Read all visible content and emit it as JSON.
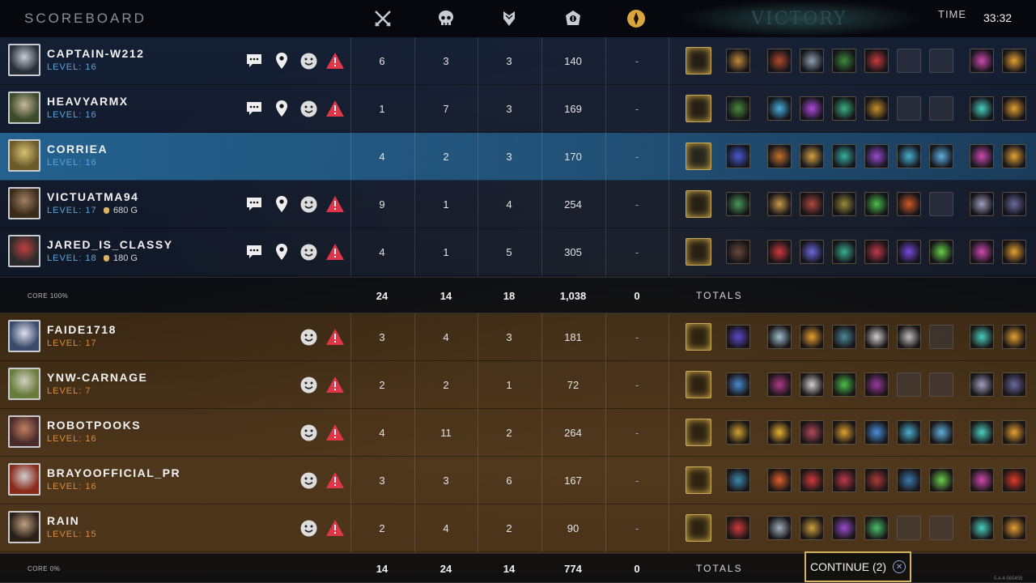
{
  "header": {
    "title": "SCOREBOARD",
    "result": "VICTORY",
    "time_label": "TIME",
    "time_value": "33:32",
    "column_icons": [
      "kills-icon",
      "deaths-icon",
      "assists-icon",
      "minions-icon",
      "objective-icon"
    ]
  },
  "colors": {
    "team_a_level": "#5aa7e0",
    "team_b_level": "#e08b3a",
    "ping_red": "#e0364a",
    "accent_gold": "#d8b25e",
    "selected_row": "#2a6fa0"
  },
  "team_a": {
    "players": [
      {
        "name": "CAPTAIN-W212",
        "level": "LEVEL: 16",
        "gold": "",
        "kills": "6",
        "deaths": "3",
        "assists": "3",
        "cs": "140",
        "obj": "-",
        "actions": true,
        "selected": false,
        "portrait": [
          "#2a2e38",
          "#c9ccd6"
        ],
        "items": [
          "#d9b24a",
          "#c48a3a",
          "#b04a2a",
          "#8da0b0",
          "#3e8a3a",
          "#c83a3a",
          "empty",
          "empty",
          "#d04ab0",
          "#e8a030"
        ]
      },
      {
        "name": "HEAVYARMX",
        "level": "LEVEL: 16",
        "gold": "",
        "kills": "1",
        "deaths": "7",
        "assists": "3",
        "cs": "169",
        "obj": "-",
        "actions": true,
        "selected": false,
        "portrait": [
          "#3a4a2a",
          "#c8b89a"
        ],
        "items": [
          "#d9b24a",
          "#4a8a3a",
          "#4ab0e0",
          "#b04ae0",
          "#3ab080",
          "#c8902a",
          "empty",
          "empty",
          "#4ad0c0",
          "#e8a030"
        ]
      },
      {
        "name": "CORRIEA",
        "level": "LEVEL: 16",
        "gold": "",
        "kills": "4",
        "deaths": "2",
        "assists": "3",
        "cs": "170",
        "obj": "-",
        "actions": false,
        "selected": true,
        "portrait": [
          "#6a5a2a",
          "#d8c070"
        ],
        "items": [
          "#d9b24a",
          "#4a5ad0",
          "#c8702a",
          "#d8a040",
          "#3ab0a0",
          "#9a4ad0",
          "#4ab0d0",
          "#60b0e0",
          "#d04ab0",
          "#e8a030"
        ]
      },
      {
        "name": "VICTUATMA94",
        "level": "LEVEL: 17",
        "gold": "680 G",
        "kills": "9",
        "deaths": "1",
        "assists": "4",
        "cs": "254",
        "obj": "-",
        "actions": true,
        "selected": false,
        "portrait": [
          "#3a2a1a",
          "#a08060"
        ],
        "items": [
          "#d9b24a",
          "#4a9a5a",
          "#c89a4a",
          "#b04a3a",
          "#9a8a3a",
          "#4ac04a",
          "#d05a2a",
          "empty",
          "#a0a0c0",
          "#6a6aa0"
        ]
      },
      {
        "name": "JARED_IS_CLASSY",
        "level": "LEVEL: 18",
        "gold": "180 G",
        "kills": "4",
        "deaths": "1",
        "assists": "5",
        "cs": "305",
        "obj": "-",
        "actions": true,
        "selected": false,
        "portrait": [
          "#2a2a2a",
          "#c04040"
        ],
        "items": [
          "#d9b24a",
          "#6a4a3a",
          "#d03a3a",
          "#6a6ae0",
          "#3ab090",
          "#c03a4a",
          "#7a4ae0",
          "#6ad04a",
          "#d04ab0",
          "#e8a030"
        ]
      }
    ],
    "core": "CORE 100%",
    "totals": {
      "kills": "24",
      "deaths": "14",
      "assists": "18",
      "cs": "1,038",
      "obj": "0",
      "label": "TOTALS"
    }
  },
  "team_b": {
    "players": [
      {
        "name": "FAIDE1718",
        "level": "LEVEL: 17",
        "gold": "",
        "kills": "3",
        "deaths": "4",
        "assists": "3",
        "cs": "181",
        "obj": "-",
        "actions": false,
        "selected": false,
        "portrait": [
          "#3a4a6a",
          "#e0e0f0"
        ],
        "items": [
          "#d9b24a",
          "#5a4ad0",
          "#a0c0d0",
          "#e8a030",
          "#4a8a9a",
          "#d0d0d0",
          "#c0c0c0",
          "empty",
          "#4ad0c0",
          "#e8a030"
        ]
      },
      {
        "name": "YNW-CARNAGE",
        "level": "LEVEL: 7",
        "gold": "",
        "kills": "2",
        "deaths": "2",
        "assists": "1",
        "cs": "72",
        "obj": "-",
        "actions": false,
        "selected": false,
        "portrait": [
          "#6a7a3a",
          "#d0d0c0"
        ],
        "items": [
          "#d9b24a",
          "#4a8ad0",
          "#b03a8a",
          "#d0d0d0",
          "#4ac04a",
          "#9a3aa0",
          "empty",
          "empty",
          "#a0a0c0",
          "#6a6aa0"
        ]
      },
      {
        "name": "ROBOTPOOKS",
        "level": "LEVEL: 16",
        "gold": "",
        "kills": "4",
        "deaths": "11",
        "assists": "2",
        "cs": "264",
        "obj": "-",
        "actions": false,
        "selected": false,
        "portrait": [
          "#4a2a2a",
          "#c08060"
        ],
        "items": [
          "#d9b24a",
          "#d0a030",
          "#e8b030",
          "#b04a5a",
          "#e0a030",
          "#4a90e0",
          "#4ab0d0",
          "#60b0e0",
          "#4ad0c0",
          "#e8a030"
        ]
      },
      {
        "name": "BRAYOOFFICIAL_PR",
        "level": "LEVEL: 16",
        "gold": "",
        "kills": "3",
        "deaths": "3",
        "assists": "6",
        "cs": "167",
        "obj": "-",
        "actions": false,
        "selected": false,
        "portrait": [
          "#8a2a1a",
          "#d0d0d0"
        ],
        "items": [
          "#d9b24a",
          "#3a8ab0",
          "#e0602a",
          "#d03a3a",
          "#c03a4a",
          "#b03a3a",
          "#3a7ab0",
          "#6ad04a",
          "#d04ab0",
          "#e03a2a"
        ]
      },
      {
        "name": "RAIN",
        "level": "LEVEL: 15",
        "gold": "",
        "kills": "2",
        "deaths": "4",
        "assists": "2",
        "cs": "90",
        "obj": "-",
        "actions": false,
        "selected": false,
        "portrait": [
          "#2a2018",
          "#c0a080"
        ],
        "items": [
          "#d9b24a",
          "#d03a3a",
          "#a0b0c0",
          "#d0a040",
          "#9a4ad0",
          "#4ac06a",
          "empty",
          "empty",
          "#4ad0c0",
          "#e8a030"
        ]
      }
    ],
    "core": "CORE 0%",
    "totals": {
      "kills": "14",
      "deaths": "24",
      "assists": "14",
      "cs": "774",
      "obj": "0",
      "label": "TOTALS"
    }
  },
  "continue_label": "CONTINUE (2)",
  "build": "5.4.4-565459"
}
